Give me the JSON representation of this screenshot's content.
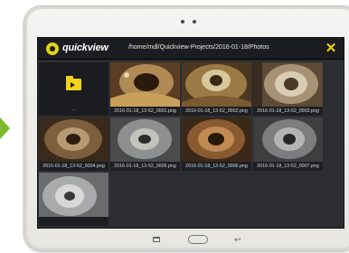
{
  "app": {
    "name": "quickview"
  },
  "header": {
    "path": "/home/mdl/Quickview-Projects/2016-01-18/Photos",
    "close_icon": "close-icon"
  },
  "colors": {
    "accent": "#f2d21b",
    "arrow": "#7dbb2a",
    "screen_bg": "#2c2e33",
    "topbar_bg": "#1c1d20"
  },
  "folder": {
    "label": "..",
    "icon": "folder-up-icon"
  },
  "photos": [
    {
      "name": "2016-01-18_13-52_0001.png"
    },
    {
      "name": "2016-01-18_13-52_0002.png"
    },
    {
      "name": "2016-01-18_13-52_0003.png"
    },
    {
      "name": "2016-01-18_13-52_0004.png"
    },
    {
      "name": "2016-01-18_13-52_0005.png"
    },
    {
      "name": "2016-01-18_13-52_0006.png"
    },
    {
      "name": "2016-01-18_13-52_0007.png"
    },
    {
      "name": ""
    }
  ],
  "device_nav": {
    "recent": "recent-apps-icon",
    "home": "home-button-icon",
    "back": "back-icon"
  }
}
